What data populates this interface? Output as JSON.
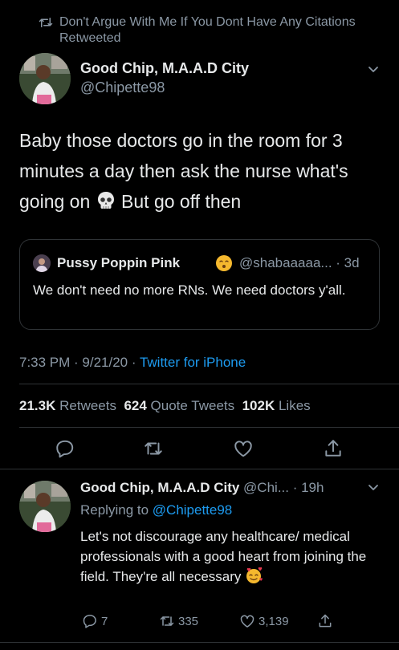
{
  "retweet_context": {
    "text": "Don't Argue With Me If You Dont Have Any Citations Retweeted"
  },
  "tweet": {
    "author_name": "Good Chip, M.A.A.D City",
    "author_handle": "@Chipette98",
    "text_part1": "Baby those doctors go in the room for 3 minutes a day then ask the nurse what's going on",
    "text_part2": " But go off then",
    "time": "7:33 PM · 9/21/20 · ",
    "source": "Twitter for iPhone"
  },
  "quote": {
    "name": "Pussy Poppin Pink",
    "handle_time": "@shabaaaaa... · 3d",
    "text": "We don't need no more RNs. We need doctors y'all."
  },
  "stats": {
    "retweets_count": "21.3K",
    "retweets_label": "Retweets",
    "quotes_count": "624",
    "quotes_label": "Quote Tweets",
    "likes_count": "102K",
    "likes_label": "Likes"
  },
  "reply": {
    "author_name": "Good Chip, M.A.A.D City",
    "handle_time": " @Chi... · 19h",
    "replying_prefix": "Replying to ",
    "replying_handle": "@Chipette98",
    "text": "Let's not discourage any healthcare/ medical professionals with a good heart from joining the field. They're all necessary",
    "reply_count": "7",
    "retweet_count": "335",
    "like_count": "3,139"
  },
  "colors": {
    "background": "#000000",
    "text": "#e7e9ea",
    "muted": "#8b98a5",
    "accent": "#1d9bf0",
    "divider": "#2f3336"
  },
  "icons": [
    "retweet-icon",
    "chevron-down-icon",
    "skull-emoji",
    "shush-emoji",
    "smiling-hearts-emoji",
    "reply-icon",
    "like-icon",
    "share-icon"
  ]
}
